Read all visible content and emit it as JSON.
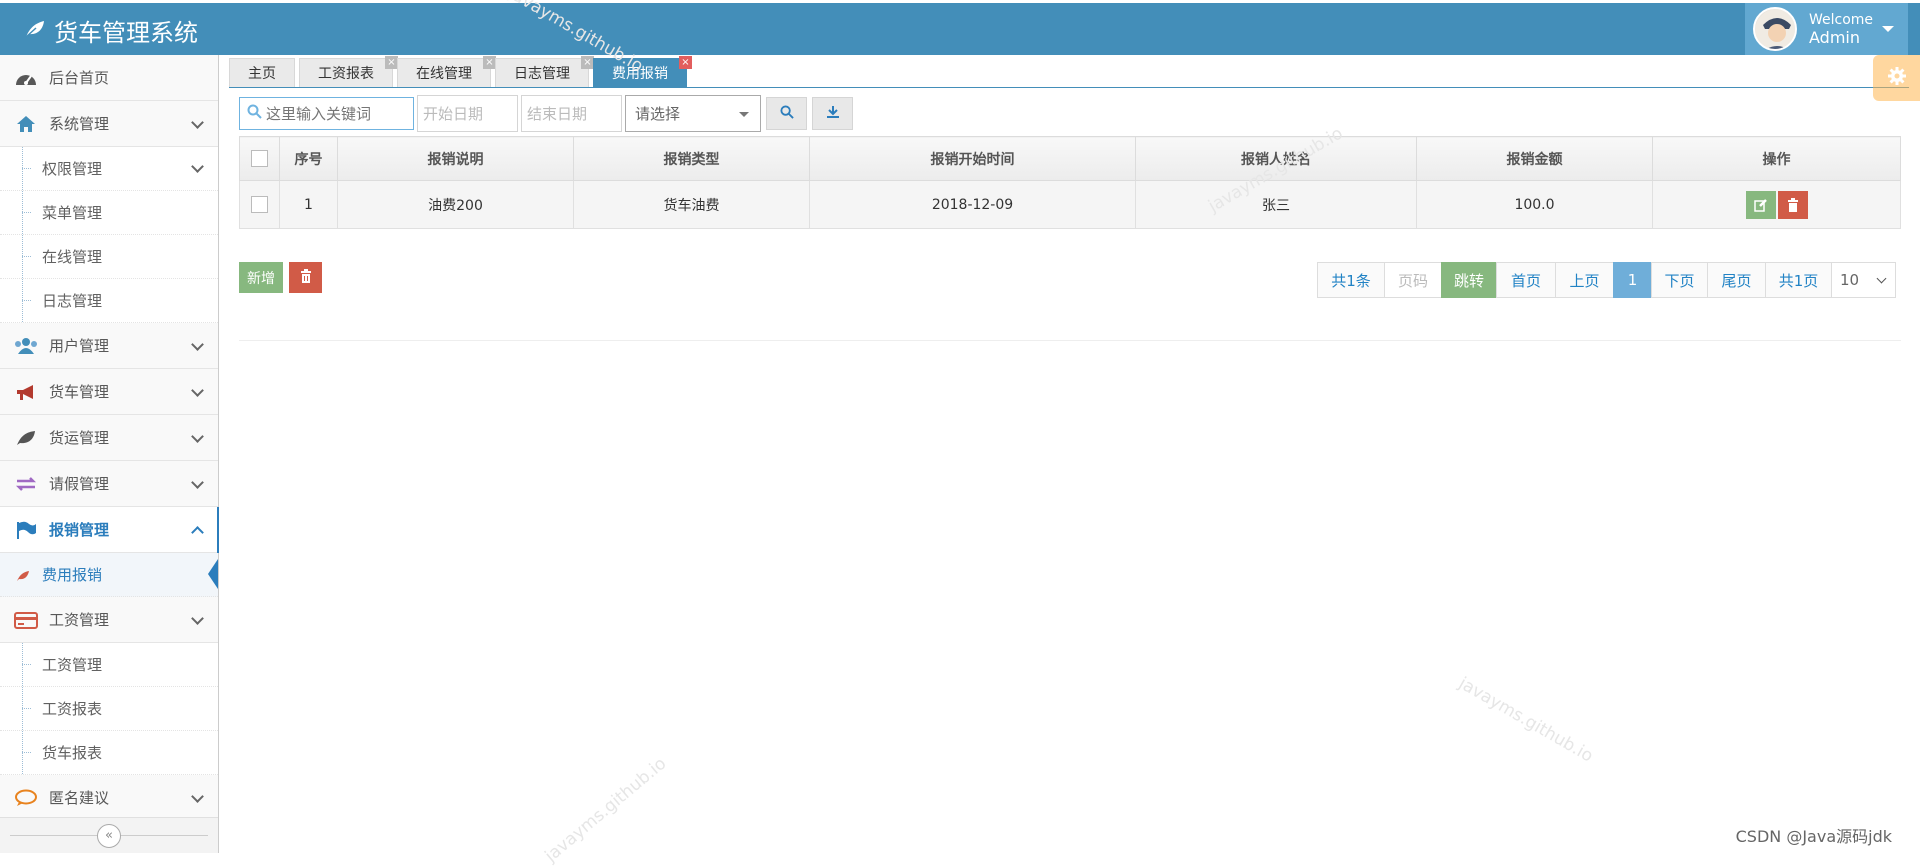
{
  "app": {
    "title": "货车管理系统"
  },
  "user": {
    "welcome": "Welcome",
    "name": "Admin"
  },
  "sidebar": {
    "items": [
      {
        "label": "后台首页"
      },
      {
        "label": "系统管理"
      },
      {
        "label": "权限管理"
      },
      {
        "label": "菜单管理"
      },
      {
        "label": "在线管理"
      },
      {
        "label": "日志管理"
      },
      {
        "label": "用户管理"
      },
      {
        "label": "货车管理"
      },
      {
        "label": "货运管理"
      },
      {
        "label": "请假管理"
      },
      {
        "label": "报销管理"
      },
      {
        "label": "费用报销"
      },
      {
        "label": "工资管理"
      },
      {
        "label": "工资管理"
      },
      {
        "label": "工资报表"
      },
      {
        "label": "货车报表"
      },
      {
        "label": "匿名建议"
      }
    ],
    "collapse_glyph": "«"
  },
  "tabs": [
    {
      "label": "主页"
    },
    {
      "label": "工资报表"
    },
    {
      "label": "在线管理"
    },
    {
      "label": "日志管理"
    },
    {
      "label": "费用报销"
    }
  ],
  "toolbar": {
    "search_placeholder": "这里输入关键词",
    "start_date": "开始日期",
    "end_date": "结束日期",
    "select_value": "请选择"
  },
  "table": {
    "headers": [
      "序号",
      "报销说明",
      "报销类型",
      "报销开始时间",
      "报销人姓名",
      "报销金额",
      "操作"
    ],
    "rows": [
      {
        "no": "1",
        "desc": "油费200",
        "type": "货车油费",
        "start": "2018-12-09",
        "name": "张三",
        "amount": "100.0"
      }
    ]
  },
  "actions": {
    "add_label": "新增"
  },
  "pager": {
    "total": "共1条",
    "page_input_placeholder": "页码",
    "go": "跳转",
    "first": "首页",
    "prev": "上页",
    "current": "1",
    "next": "下页",
    "last": "尾页",
    "pages": "共1页",
    "size": "10"
  },
  "watermark": "javayms.github.io",
  "footer": {
    "credit": "CSDN @Java源码jdk"
  },
  "colors": {
    "navbar": "#438eb9",
    "accent": "#2b7dbc",
    "success": "#87b87f",
    "danger": "#d15b47"
  }
}
